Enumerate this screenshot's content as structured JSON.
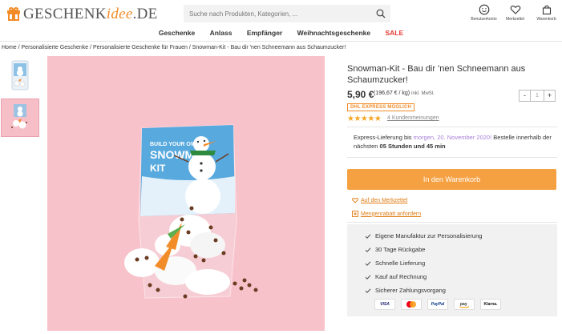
{
  "header": {
    "logo_main": "GESCHENK",
    "logo_accent": "idee",
    "logo_suffix": ".DE",
    "search_placeholder": "Suche nach Produkten, Kategorien, ...",
    "icons": [
      {
        "name": "smiley-icon",
        "label": "Benutzerkonto"
      },
      {
        "name": "heart-icon",
        "label": "Merkzettel"
      },
      {
        "name": "bag-icon",
        "label": "Warenkorb"
      }
    ]
  },
  "nav": {
    "items": [
      "Geschenke",
      "Anlass",
      "Empfänger",
      "Weihnachtsgeschenke"
    ],
    "sale": "SALE"
  },
  "breadcrumb": "Home / Personalisierte Geschenke / Personalisierte Geschenke für Frauen /  Snowman-Kit - Bau dir 'nen Schneemann aus Schaumzucker!",
  "product": {
    "title": "Snowman-Kit - Bau dir 'nen Schneemann aus Schaumzucker!",
    "price": "5,90 €",
    "unit_price": "(196,67 € / kg)",
    "vat": "inkl. MwSt.",
    "qty_minus": "-",
    "qty_value": "1",
    "qty_plus": "+",
    "dhl_badge": "DHL EXPRESS MÖGLICH",
    "rating": 5,
    "stars": "★★★★★",
    "reviews_link": "4 Kundenmeinungen",
    "delivery": {
      "prefix": "Express-Lieferung bis ",
      "date": "morgen, 20. November 2020!",
      "middle": " Bestelle innerhalb der nächsten ",
      "time": "05 Stunden und 45 min"
    },
    "cart_button": "In den Warenkorb",
    "wishlist_link": "Auf den Merkzettel",
    "bulk_link": "Mengenrabatt anfordern",
    "benefits": [
      "Eigene Manufaktur zur Personalisierung",
      "30 Tage Rückgabe",
      "Schnelle Lieferung",
      "Kauf auf Rechnung",
      "Sicherer Zahlungsvorgang"
    ],
    "payment_methods": [
      "VISA",
      "Mastercard",
      "PayPal",
      "Amazon Pay",
      "Klarna."
    ],
    "image_text": {
      "bag_line1": "BUILD YOUR OWN",
      "bag_line2": "SNOWMAN",
      "bag_line3": "KIT"
    }
  },
  "colors": {
    "accent": "#f28c28",
    "sale": "#e53935",
    "cart_button": "#f5a142",
    "star": "#f5a623",
    "delivery_date": "#a77fd6",
    "image_bg": "#f8c2cb"
  }
}
